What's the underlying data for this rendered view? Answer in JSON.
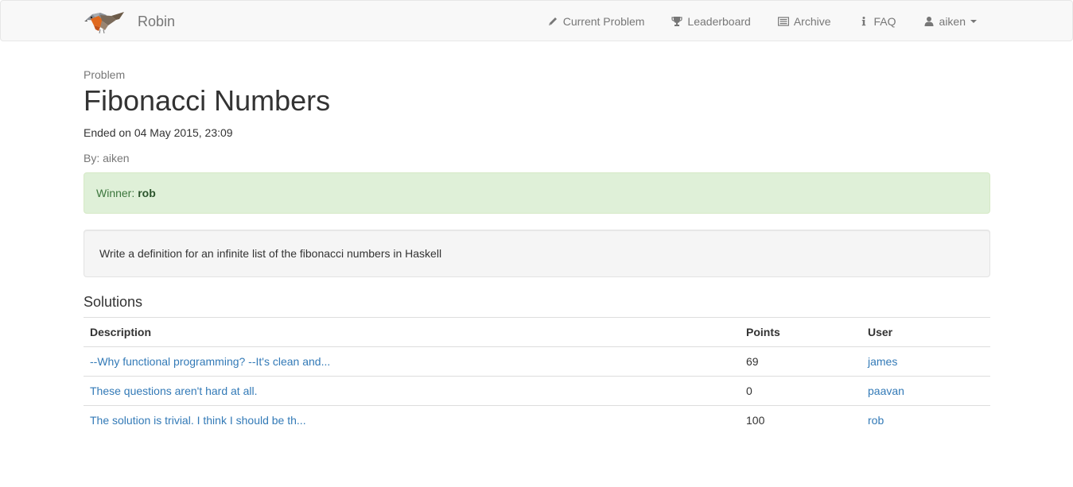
{
  "navbar": {
    "brand": "Robin",
    "logo_icon": "robin-bird-icon",
    "items": [
      {
        "label": "Current Problem",
        "icon": "pencil-icon"
      },
      {
        "label": "Leaderboard",
        "icon": "trophy-icon"
      },
      {
        "label": "Archive",
        "icon": "list-alt-icon"
      },
      {
        "label": "FAQ",
        "icon": "info-icon"
      }
    ],
    "user": {
      "label": "aiken",
      "icon": "user-icon"
    }
  },
  "problem": {
    "label": "Problem",
    "title": "Fibonacci Numbers",
    "ended": "Ended on 04 May 2015, 23:09",
    "author": "By: aiken",
    "winner_label": "Winner:",
    "winner_name": "rob",
    "description": "Write a definition for an infinite list of the fibonacci numbers in Haskell"
  },
  "solutions": {
    "heading": "Solutions",
    "columns": [
      "Description",
      "Points",
      "User"
    ],
    "rows": [
      {
        "description": "--Why functional programming? --It's clean and...",
        "points": "69",
        "user": "james"
      },
      {
        "description": "These questions aren't hard at all.",
        "points": "0",
        "user": "paavan"
      },
      {
        "description": "The solution is trivial. I think I should be th...",
        "points": "100",
        "user": "rob"
      }
    ]
  },
  "colors": {
    "link": "#337ab7",
    "success_bg": "#dff0d8",
    "success_text": "#3c763d",
    "navbar_bg": "#f8f8f8"
  }
}
